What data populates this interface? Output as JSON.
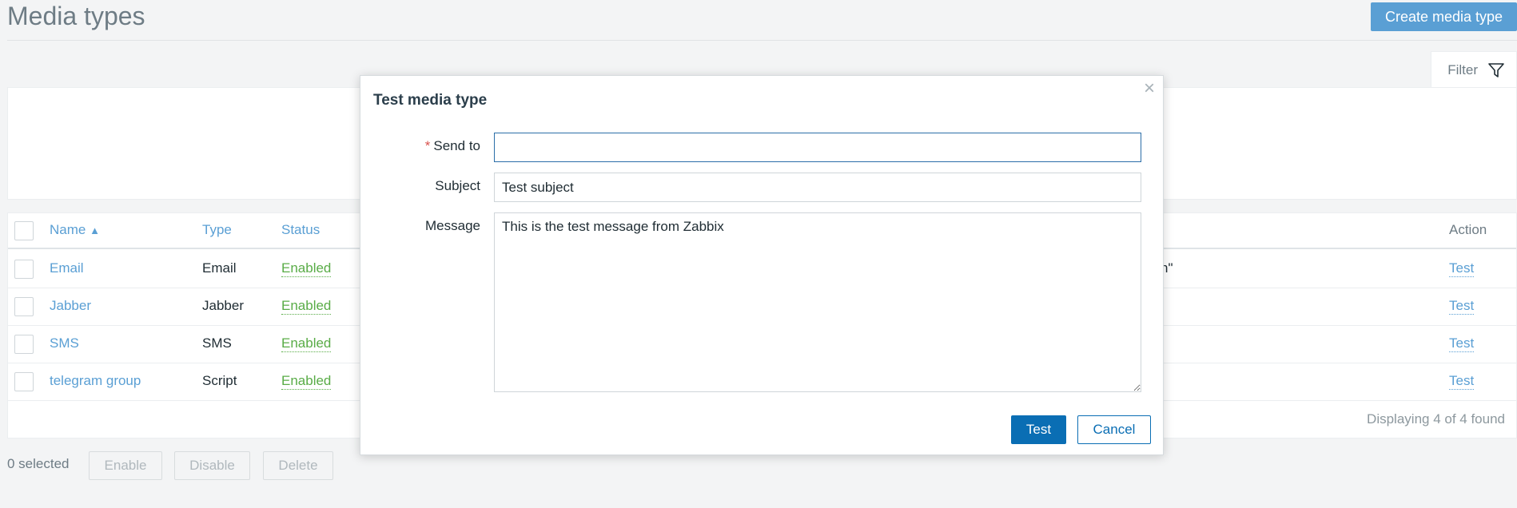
{
  "header": {
    "title": "Media types",
    "create_button": "Create media type"
  },
  "filter": {
    "label": "Filter"
  },
  "table": {
    "columns": {
      "name": "Name",
      "sort_indicator": "▲",
      "type": "Type",
      "status": "Status",
      "action": "Action"
    },
    "rows": [
      {
        "name": "Email",
        "type": "Email",
        "status": "Enabled",
        "details_fragment": "n\"",
        "action": "Test"
      },
      {
        "name": "Jabber",
        "type": "Jabber",
        "status": "Enabled",
        "action": "Test"
      },
      {
        "name": "SMS",
        "type": "SMS",
        "status": "Enabled",
        "action": "Test"
      },
      {
        "name": "telegram group",
        "type": "Script",
        "status": "Enabled",
        "action": "Test"
      }
    ],
    "footer": "Displaying 4 of 4 found"
  },
  "bulk": {
    "selected": "0 selected",
    "enable": "Enable",
    "disable": "Disable",
    "delete": "Delete"
  },
  "dialog": {
    "title": "Test media type",
    "close": "×",
    "required_marker": "*",
    "send_to_label": "Send to",
    "send_to_value": "",
    "subject_label": "Subject",
    "subject_value": "Test subject",
    "message_label": "Message",
    "message_value": "This is the test message from Zabbix",
    "test_button": "Test",
    "cancel_button": "Cancel"
  },
  "colors": {
    "link": "#5a9fd4",
    "enabled": "#59ac47",
    "primary": "#0a6eb4",
    "required": "#d9534f"
  },
  "icons": {
    "filter": "funnel-icon"
  }
}
